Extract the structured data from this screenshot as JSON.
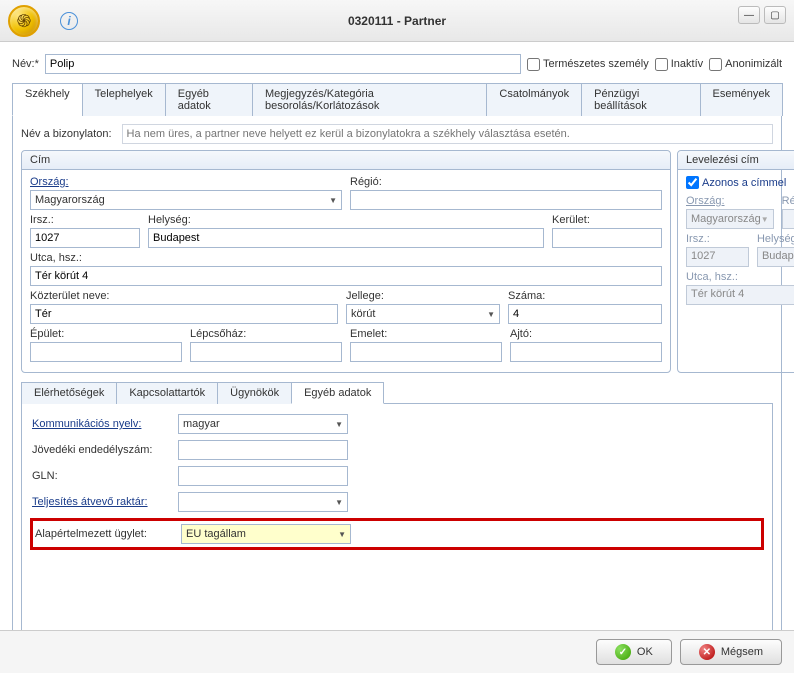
{
  "window": {
    "title": "0320111 - Partner",
    "minimize": "—",
    "maximize": "▢"
  },
  "nameRow": {
    "label": "Név:*",
    "value": "Polip",
    "chkNatural": "Természetes személy",
    "chkInactive": "Inaktív",
    "chkAnon": "Anonimizált"
  },
  "mainTabs": {
    "szekhely": "Székhely",
    "telephelyek": "Telephelyek",
    "egyeb": "Egyéb adatok",
    "megjegyzes": "Megjegyzés/Kategória besorolás/Korlátozások",
    "csatolmanyok": "Csatolmányok",
    "penzugyi": "Pénzügyi beállítások",
    "esemenyek": "Események"
  },
  "hint": {
    "label": "Név a bizonylaton:",
    "placeholder": "Ha nem üres, a partner neve helyett ez kerül a bizonylatokra a székhely választása esetén."
  },
  "cim": {
    "title": "Cím",
    "orszagLabel": "Ország:",
    "orszagValue": "Magyarország",
    "regioLabel": "Régió:",
    "irszLabel": "Irsz.:",
    "irszValue": "1027",
    "helysegLabel": "Helység:",
    "helysegValue": "Budapest",
    "keruletLabel": "Kerület:",
    "utcaLabel": "Utca, hsz.:",
    "utcaValue": "Tér körút 4",
    "kozteruletLabel": "Közterület neve:",
    "kozteruletValue": "Tér",
    "jellegeLabel": "Jellege:",
    "jellegeValue": "körút",
    "szamaLabel": "Száma:",
    "szamaValue": "4",
    "epuletLabel": "Épület:",
    "lepcsohazLabel": "Lépcsőház:",
    "emeletLabel": "Emelet:",
    "ajtoLabel": "Ajtó:"
  },
  "lev": {
    "title": "Levelezési cím",
    "azonos": "Azonos a címmel",
    "orszagLabel": "Ország:",
    "orszagValue": "Magyarország",
    "regioLabel": "Régió:",
    "irszLabel": "Irsz.:",
    "irszValue": "1027",
    "helysegLabel": "Helység:",
    "helysegValue": "Budapest",
    "utcaLabel": "Utca, hsz.:",
    "utcaValue": "Tér körút 4"
  },
  "innerTabs": {
    "elerheto": "Elérhetőségek",
    "kapcsolat": "Kapcsolattartók",
    "ugynokok": "Ügynökök",
    "egyeb": "Egyéb adatok"
  },
  "egyeb": {
    "kommLabel": "Kommunikációs nyelv:",
    "kommValue": "magyar",
    "jovedekiLabel": "Jövedéki endedélyszám:",
    "glnLabel": "GLN:",
    "teljesitesLabel": "Teljesítés átvevő raktár:",
    "alapLabel": "Alapértelmezett ügylet:",
    "alapValue": "EU tagállam"
  },
  "footer": {
    "ok": "OK",
    "cancel": "Mégsem"
  }
}
